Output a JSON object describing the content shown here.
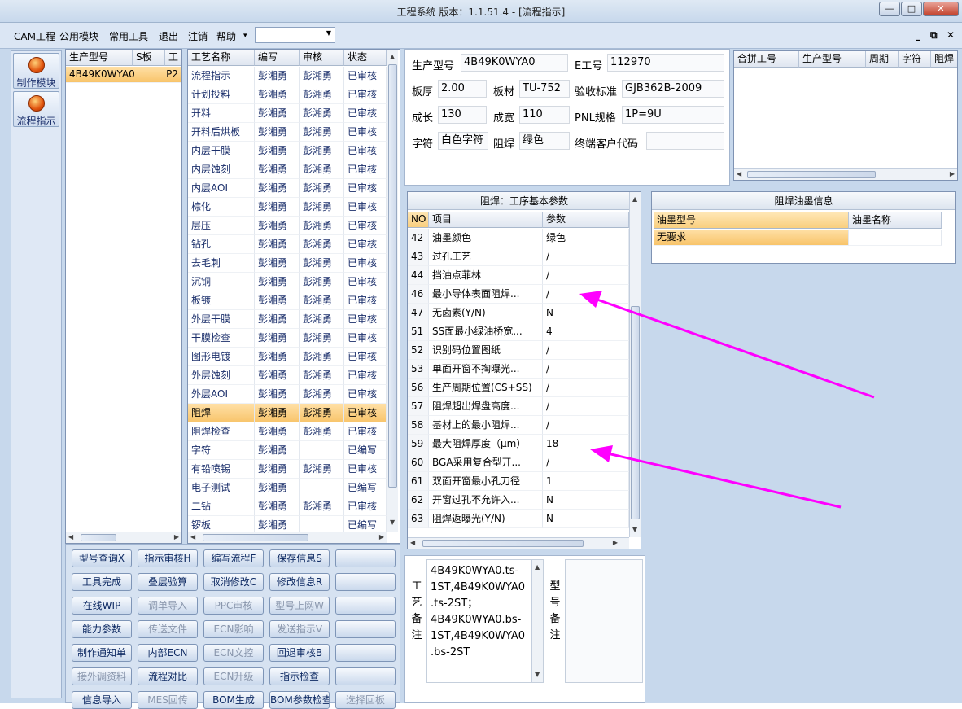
{
  "window": {
    "title": "工程系统   版本：1.1.51.4 - [流程指示]",
    "min_label": "—",
    "max_label": "□",
    "close_label": "✕"
  },
  "menu": {
    "items": [
      "CAM工程",
      "公用模块",
      "常用工具",
      "退出",
      "注销",
      "帮助"
    ],
    "help_arrow": "▾",
    "combo_value": "",
    "mdi_min": "_",
    "mdi_restore": "⧉",
    "mdi_close": "✕"
  },
  "nav": {
    "make_module": "制作模块",
    "flow_guide": "流程指示"
  },
  "model_grid": {
    "headers": [
      "生产型号",
      "S板",
      "工"
    ],
    "row": {
      "model": "4B49K0WYA0",
      "code": "P2"
    }
  },
  "process_grid": {
    "headers": [
      "工艺名称",
      "编写",
      "审核",
      "状态"
    ],
    "rows": [
      {
        "name": "流程指示",
        "writer": "彭湘勇",
        "reviewer": "彭湘勇",
        "status": "已审核"
      },
      {
        "name": "计划投料",
        "writer": "彭湘勇",
        "reviewer": "彭湘勇",
        "status": "已审核"
      },
      {
        "name": "开料",
        "writer": "彭湘勇",
        "reviewer": "彭湘勇",
        "status": "已审核"
      },
      {
        "name": "开料后烘板",
        "writer": "彭湘勇",
        "reviewer": "彭湘勇",
        "status": "已审核"
      },
      {
        "name": "内层干膜",
        "writer": "彭湘勇",
        "reviewer": "彭湘勇",
        "status": "已审核"
      },
      {
        "name": "内层蚀刻",
        "writer": "彭湘勇",
        "reviewer": "彭湘勇",
        "status": "已审核"
      },
      {
        "name": "内层AOI",
        "writer": "彭湘勇",
        "reviewer": "彭湘勇",
        "status": "已审核"
      },
      {
        "name": "棕化",
        "writer": "彭湘勇",
        "reviewer": "彭湘勇",
        "status": "已审核"
      },
      {
        "name": "层压",
        "writer": "彭湘勇",
        "reviewer": "彭湘勇",
        "status": "已审核"
      },
      {
        "name": "钻孔",
        "writer": "彭湘勇",
        "reviewer": "彭湘勇",
        "status": "已审核"
      },
      {
        "name": "去毛刺",
        "writer": "彭湘勇",
        "reviewer": "彭湘勇",
        "status": "已审核"
      },
      {
        "name": "沉铜",
        "writer": "彭湘勇",
        "reviewer": "彭湘勇",
        "status": "已审核"
      },
      {
        "name": "板镀",
        "writer": "彭湘勇",
        "reviewer": "彭湘勇",
        "status": "已审核"
      },
      {
        "name": "外层干膜",
        "writer": "彭湘勇",
        "reviewer": "彭湘勇",
        "status": "已审核"
      },
      {
        "name": "干膜检查",
        "writer": "彭湘勇",
        "reviewer": "彭湘勇",
        "status": "已审核"
      },
      {
        "name": "图形电镀",
        "writer": "彭湘勇",
        "reviewer": "彭湘勇",
        "status": "已审核"
      },
      {
        "name": "外层蚀刻",
        "writer": "彭湘勇",
        "reviewer": "彭湘勇",
        "status": "已审核"
      },
      {
        "name": "外层AOI",
        "writer": "彭湘勇",
        "reviewer": "彭湘勇",
        "status": "已审核"
      },
      {
        "name": "阻焊",
        "writer": "彭湘勇",
        "reviewer": "彭湘勇",
        "status": "已审核"
      },
      {
        "name": "阻焊检查",
        "writer": "彭湘勇",
        "reviewer": "彭湘勇",
        "status": "已审核"
      },
      {
        "name": "字符",
        "writer": "彭湘勇",
        "reviewer": "",
        "status": "已编写"
      },
      {
        "name": "有铅喷锡",
        "writer": "彭湘勇",
        "reviewer": "彭湘勇",
        "status": "已审核"
      },
      {
        "name": "电子测试",
        "writer": "彭湘勇",
        "reviewer": "",
        "status": "已编写"
      },
      {
        "name": "二钻",
        "writer": "彭湘勇",
        "reviewer": "彭湘勇",
        "status": "已审核"
      },
      {
        "name": "锣板",
        "writer": "彭湘勇",
        "reviewer": "",
        "status": "已编写"
      }
    ]
  },
  "buttons": [
    [
      "型号查询X",
      "指示审核H",
      "编写流程F",
      "保存信息S",
      ""
    ],
    [
      "工具完成",
      "叠层验算",
      "取消修改C",
      "修改信息R",
      ""
    ],
    [
      "在线WIP",
      "调单导入",
      "PPC审核",
      "型号上网W",
      ""
    ],
    [
      "能力参数",
      "传送文件",
      "ECN影响",
      "发送指示V",
      ""
    ],
    [
      "制作通知单",
      "内部ECN",
      "ECN文控",
      "回退审核B",
      ""
    ],
    [
      "接外调资料",
      "流程对比",
      "ECN升级",
      "指示检查",
      ""
    ],
    [
      "信息导入",
      "MES回传",
      "BOM生成",
      "BOM参数检查",
      "选择回板"
    ]
  ],
  "info": {
    "model_label": "生产型号",
    "model": "4B49K0WYA0",
    "eno_label": "E工号",
    "eno": "112970",
    "thick_label": "板厚",
    "thick": "2.00",
    "material_label": "板材",
    "material": "TU-752",
    "std_label": "验收标准",
    "std": "GJB362B-2009",
    "len_label": "成长",
    "len": "130",
    "wid_label": "成宽",
    "wid": "110",
    "pnl_label": "PNL规格",
    "pnl": "1P=9U",
    "char_label": "字符",
    "char": "白色字符",
    "mask_label": "阻焊",
    "mask": "绿色",
    "cust_label": "终端客户代码",
    "cust": ""
  },
  "merge_grid": {
    "headers": [
      "合拼工号",
      "生产型号",
      "周期",
      "字符",
      "阻焊"
    ]
  },
  "params": {
    "title": "阻焊：工序基本参数",
    "headers": [
      "NO",
      "项目",
      "参数"
    ],
    "rows": [
      {
        "no": "42",
        "item": "油墨颜色",
        "value": "绿色"
      },
      {
        "no": "43",
        "item": "过孔工艺",
        "value": "/"
      },
      {
        "no": "44",
        "item": "挡油点菲林",
        "value": "/"
      },
      {
        "no": "46",
        "item": "最小导体表面阻焊...",
        "value": "/"
      },
      {
        "no": "47",
        "item": "无卤素(Y/N)",
        "value": "N"
      },
      {
        "no": "51",
        "item": "SS面最小绿油桥宽...",
        "value": "4"
      },
      {
        "no": "52",
        "item": "识别码位置图纸",
        "value": "/"
      },
      {
        "no": "53",
        "item": "单面开窗不掏曝光...",
        "value": "/"
      },
      {
        "no": "56",
        "item": "生产周期位置(CS+SS)",
        "value": "/"
      },
      {
        "no": "57",
        "item": "阻焊超出焊盘高度...",
        "value": "/"
      },
      {
        "no": "58",
        "item": "基材上的最小阻焊...",
        "value": "/"
      },
      {
        "no": "59",
        "item": "最大阻焊厚度（μm）",
        "value": "18"
      },
      {
        "no": "60",
        "item": "BGA采用复合型开...",
        "value": "/"
      },
      {
        "no": "61",
        "item": "双面开窗最小孔刀径",
        "value": "1"
      },
      {
        "no": "62",
        "item": "开窗过孔不允许入...",
        "value": "N"
      },
      {
        "no": "63",
        "item": "阻焊返曝光(Y/N)",
        "value": "N"
      }
    ]
  },
  "ink": {
    "title": "阻焊油墨信息",
    "headers": [
      "油墨型号",
      "油墨名称"
    ],
    "row": {
      "model": "无要求",
      "name": ""
    }
  },
  "notes": {
    "process_label": [
      "工",
      "艺",
      "备",
      "注"
    ],
    "process_lines": [
      "4B49K0WYA0.ts-",
      "1ST,4B49K0WYA0",
      ".ts-2ST；",
      "4B49K0WYA0.bs-",
      "1ST,4B49K0WYA0",
      ".bs-2ST"
    ],
    "model_label": [
      "型",
      "号",
      "备",
      "注"
    ]
  },
  "colors": {
    "selection": "#f8c46a",
    "arrow": "#ff00ff",
    "frame": "#c7d8ec",
    "link_text": "#1b2f6b"
  }
}
